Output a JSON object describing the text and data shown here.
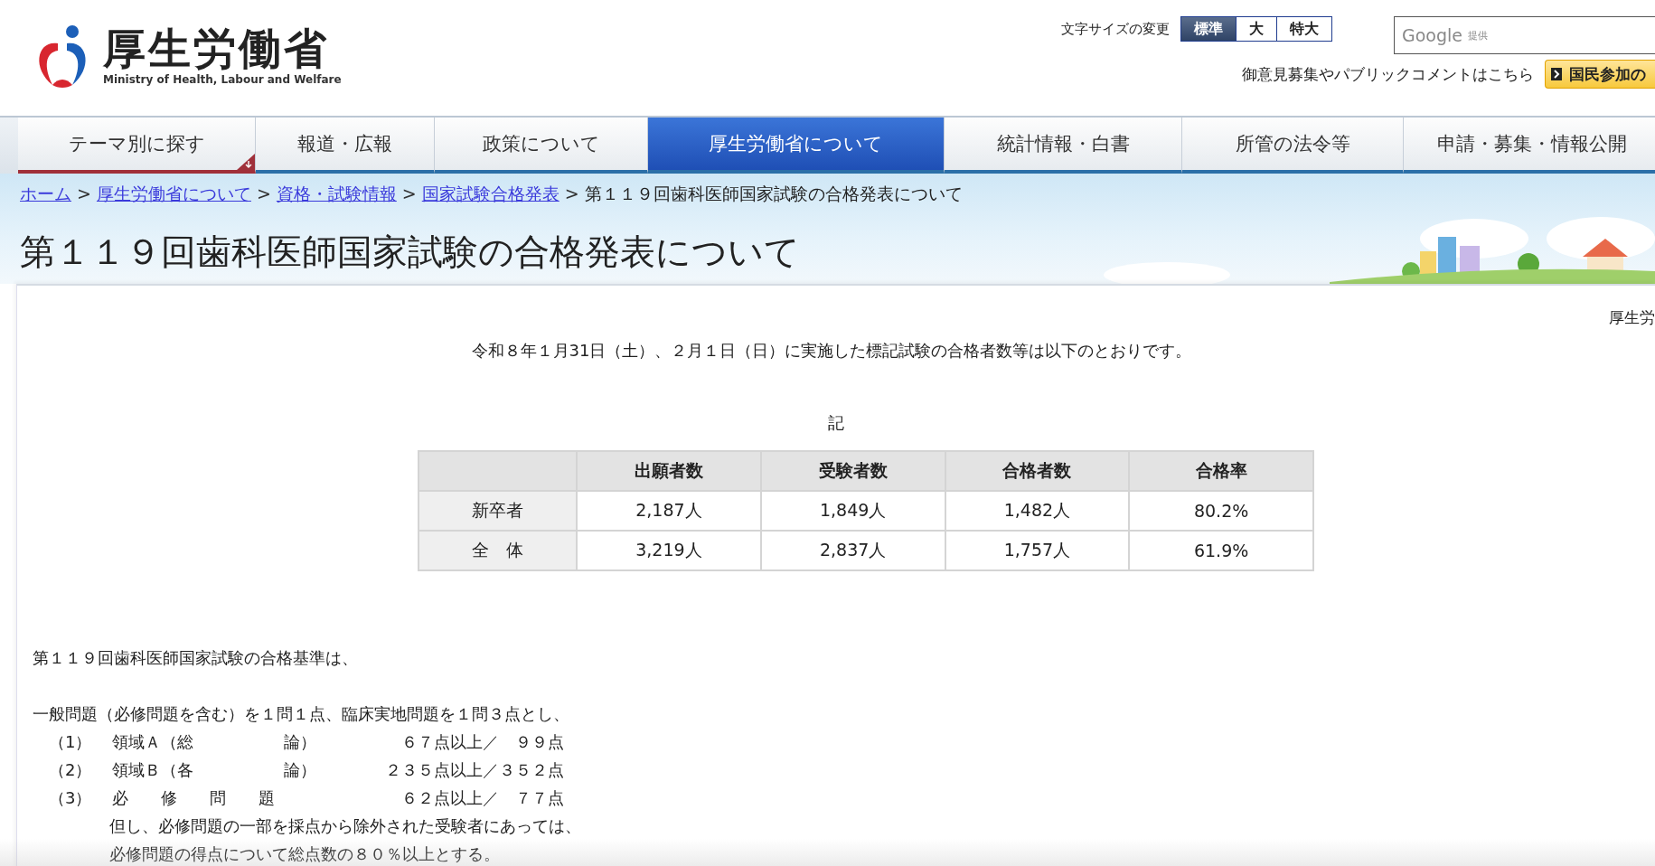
{
  "header": {
    "logo": {
      "title": "厚生労働省",
      "subtitle": "Ministry of Health, Labour and Welfare"
    },
    "font_size": {
      "label": "文字サイズの変更",
      "options": [
        {
          "label": "標準",
          "selected": true
        },
        {
          "label": "大",
          "selected": false
        },
        {
          "label": "特大",
          "selected": false
        }
      ]
    },
    "search": {
      "provider": "Google",
      "provided": "提供"
    },
    "comment_link": "御意見募集やパブリックコメントはこちら",
    "participation_button": "国民参加の"
  },
  "nav": [
    {
      "label": "テーマ別に探す",
      "selected": false,
      "kind": "menu"
    },
    {
      "label": "報道・広報",
      "selected": false,
      "kind": "link"
    },
    {
      "label": "政策について",
      "selected": false,
      "kind": "link"
    },
    {
      "label": "厚生労働省について",
      "selected": true,
      "kind": "link"
    },
    {
      "label": "統計情報・白書",
      "selected": false,
      "kind": "link"
    },
    {
      "label": "所管の法令等",
      "selected": false,
      "kind": "link"
    },
    {
      "label": "申請・募集・情報公開",
      "selected": false,
      "kind": "link"
    }
  ],
  "breadcrumb": {
    "links": [
      "ホーム",
      "厚生労働省について",
      "資格・試験情報",
      "国家試験合格発表"
    ],
    "separator": ">",
    "current": "第１１９回歯科医師国家試験の合格発表について"
  },
  "page_title": "第１１９回歯科医師国家試験の合格発表について",
  "corner_text": "厚生労",
  "intro": "令和８年１月31日（土）、２月１日（日）に実施した標記試験の合格者数等は以下のとおりです。",
  "note_heading": "記",
  "table": {
    "columns": [
      "出願者数",
      "受験者数",
      "合格者数",
      "合格率"
    ],
    "rows": [
      {
        "label": "新卒者",
        "cells": [
          "2,187人",
          "1,849人",
          "1,482人",
          "80.2%"
        ]
      },
      {
        "label": "全　体",
        "cells": [
          "3,219人",
          "2,837人",
          "1,757人",
          "61.9%"
        ]
      }
    ]
  },
  "criteria": {
    "heading": "第１１９回歯科医師国家試験の合格基準は、",
    "scoring": "一般問題（必修問題を含む）を１問１点、臨床実地問題を１問３点とし、",
    "items": [
      {
        "number": "（1）",
        "name": "領域Ａ（総",
        "name_end": "論）",
        "score": "６７点以上／　９９点"
      },
      {
        "number": "（2）",
        "name": "領域Ｂ（各",
        "name_end": "論）",
        "score": "２３５点以上／３５２点"
      },
      {
        "number": "（3）",
        "name": "必　　修　　問　　題",
        "score": "６２点以上／　７７点"
      }
    ],
    "notes": [
      "但し、必修問題の一部を採点から除外された受験者にあっては、",
      "必修問題の得点について総点数の８０％以上とする。"
    ]
  }
}
